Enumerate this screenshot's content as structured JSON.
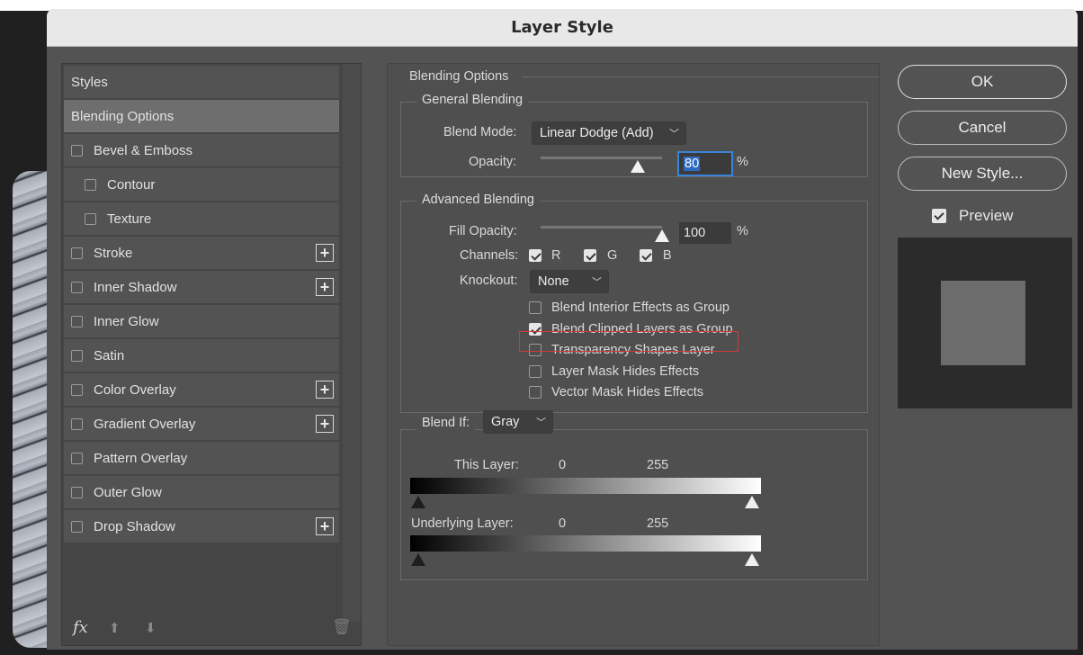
{
  "dialog": {
    "title": "Layer Style"
  },
  "styles_panel": {
    "header": "Styles",
    "selected": "Blending Options",
    "items": [
      {
        "label": "Blending Options",
        "checkbox": false,
        "indent": 0,
        "plus": false
      },
      {
        "label": "Bevel & Emboss",
        "checkbox": true,
        "checked": false,
        "indent": 0,
        "plus": false
      },
      {
        "label": "Contour",
        "checkbox": true,
        "checked": false,
        "indent": 1,
        "plus": false
      },
      {
        "label": "Texture",
        "checkbox": true,
        "checked": false,
        "indent": 1,
        "plus": false
      },
      {
        "label": "Stroke",
        "checkbox": true,
        "checked": false,
        "indent": 0,
        "plus": true
      },
      {
        "label": "Inner Shadow",
        "checkbox": true,
        "checked": false,
        "indent": 0,
        "plus": true
      },
      {
        "label": "Inner Glow",
        "checkbox": true,
        "checked": false,
        "indent": 0,
        "plus": false
      },
      {
        "label": "Satin",
        "checkbox": true,
        "checked": false,
        "indent": 0,
        "plus": false
      },
      {
        "label": "Color Overlay",
        "checkbox": true,
        "checked": false,
        "indent": 0,
        "plus": true
      },
      {
        "label": "Gradient Overlay",
        "checkbox": true,
        "checked": false,
        "indent": 0,
        "plus": true
      },
      {
        "label": "Pattern Overlay",
        "checkbox": true,
        "checked": false,
        "indent": 0,
        "plus": false
      },
      {
        "label": "Outer Glow",
        "checkbox": true,
        "checked": false,
        "indent": 0,
        "plus": false
      },
      {
        "label": "Drop Shadow",
        "checkbox": true,
        "checked": false,
        "indent": 0,
        "plus": true
      }
    ],
    "footer": {
      "fx_label": "fx",
      "icons": [
        "fx-icon",
        "move-up-icon",
        "move-down-icon",
        "trash-icon"
      ]
    }
  },
  "blending": {
    "section_title": "Blending Options",
    "general": {
      "title": "General Blending",
      "blend_mode_label": "Blend Mode:",
      "blend_mode_value": "Linear Dodge (Add)",
      "opacity_label": "Opacity:",
      "opacity_value": "80",
      "opacity_fraction": 0.8,
      "percent": "%"
    },
    "advanced": {
      "title": "Advanced Blending",
      "fill_opacity_label": "Fill Opacity:",
      "fill_opacity_value": "100",
      "fill_opacity_fraction": 1.0,
      "percent": "%",
      "channels_label": "Channels:",
      "channels": [
        {
          "label": "R",
          "checked": true
        },
        {
          "label": "G",
          "checked": true
        },
        {
          "label": "B",
          "checked": true
        }
      ],
      "knockout_label": "Knockout:",
      "knockout_value": "None",
      "options": [
        {
          "label": "Blend Interior Effects as Group",
          "checked": false
        },
        {
          "label": "Blend Clipped Layers as Group",
          "checked": true
        },
        {
          "label": "Transparency Shapes Layer",
          "checked": false,
          "highlighted": true
        },
        {
          "label": "Layer Mask Hides Effects",
          "checked": false
        },
        {
          "label": "Vector Mask Hides Effects",
          "checked": false
        }
      ]
    },
    "blend_if": {
      "label": "Blend If:",
      "value": "Gray",
      "this_layer_label": "This Layer:",
      "this_layer_min": "0",
      "this_layer_max": "255",
      "underlying_label": "Underlying Layer:",
      "underlying_min": "0",
      "underlying_max": "255"
    }
  },
  "buttons": {
    "ok": "OK",
    "cancel": "Cancel",
    "new_style": "New Style..."
  },
  "preview": {
    "label": "Preview",
    "checked": true
  },
  "colors": {
    "highlight": "#d23a3a",
    "focus": "#3b83d8"
  }
}
